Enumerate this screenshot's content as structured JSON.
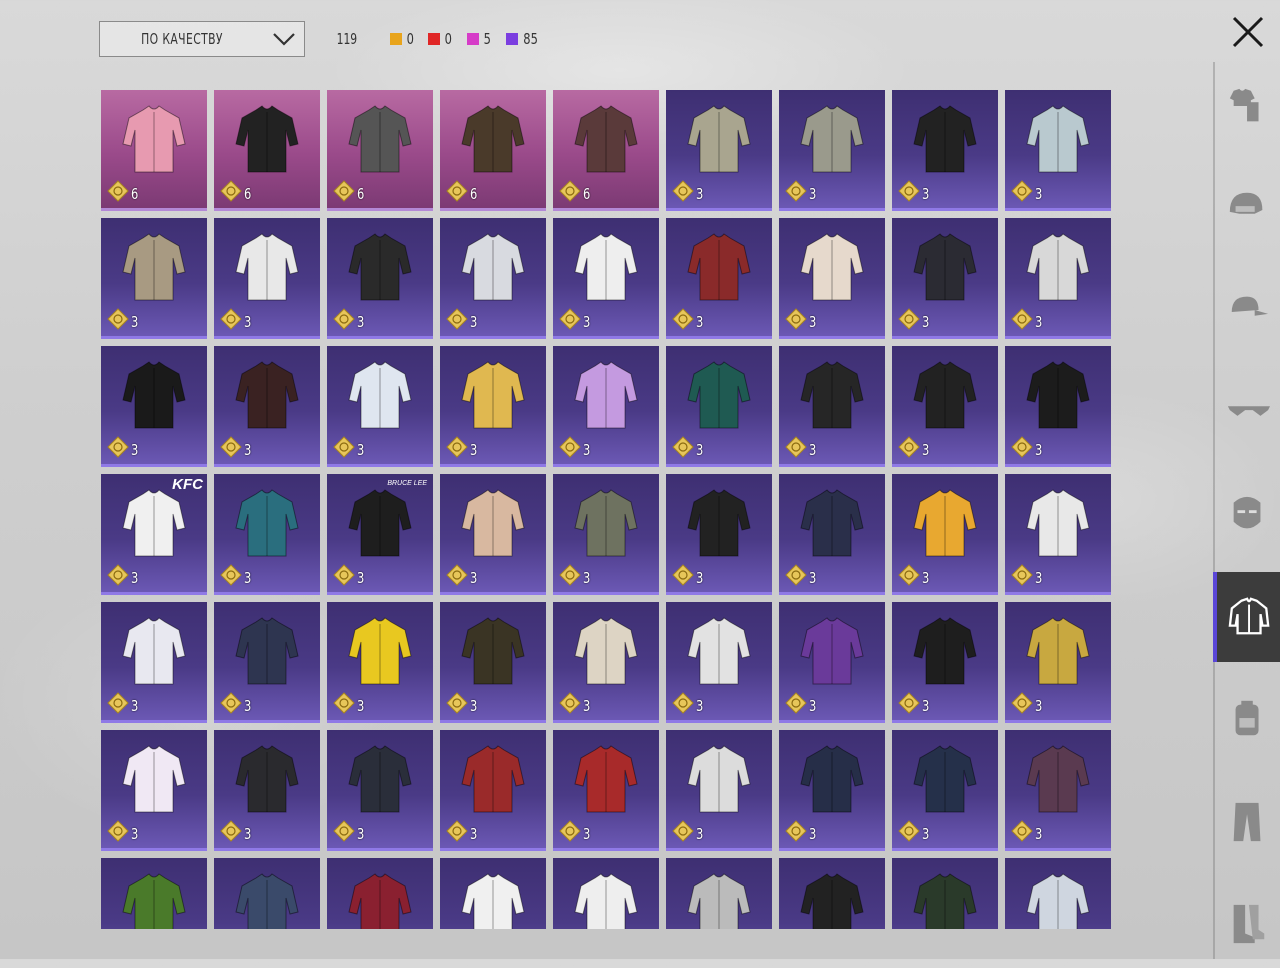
{
  "sort": {
    "label": "ПО КАЧЕСТВУ",
    "icon": "chevron-down-icon"
  },
  "counts": {
    "total": "119",
    "rarities": [
      {
        "name": "legendary-gold",
        "color": "#e8a41c",
        "value": "0"
      },
      {
        "name": "mythic-red",
        "color": "#e02626",
        "value": "0"
      },
      {
        "name": "legendary-pink",
        "color": "#d63cc8",
        "value": "5"
      },
      {
        "name": "epic-purple",
        "color": "#7b3ee0",
        "value": "85"
      }
    ]
  },
  "close_icon": "close-icon",
  "items": [
    {
      "rarity": "legendary",
      "icon": "pink-white-shirt-icon",
      "color": "#e79ab0",
      "count": "6"
    },
    {
      "rarity": "legendary",
      "icon": "black-hoodie-icon",
      "color": "#222222",
      "count": "6"
    },
    {
      "rarity": "legendary",
      "icon": "grey-puffer-jacket-icon",
      "color": "#555555",
      "count": "6"
    },
    {
      "rarity": "legendary",
      "icon": "hooded-long-coat-icon",
      "color": "#4a3a2a",
      "count": "6"
    },
    {
      "rarity": "legendary",
      "icon": "long-trench-coat-icon",
      "color": "#5a3a3a",
      "count": "6"
    },
    {
      "rarity": "epic",
      "icon": "camo-jacket-icon",
      "color": "#a9a58f",
      "count": "3"
    },
    {
      "rarity": "epic",
      "icon": "grey-hoodie-icon",
      "color": "#9a9a8c",
      "count": "3"
    },
    {
      "rarity": "epic",
      "icon": "black-crop-top-icon",
      "color": "#222222",
      "count": "3"
    },
    {
      "rarity": "epic",
      "icon": "floral-shirt-icon",
      "color": "#b9c9cf",
      "count": "3"
    },
    {
      "rarity": "epic",
      "icon": "plaid-jacket-icon",
      "color": "#a89a82",
      "count": "3"
    },
    {
      "rarity": "epic",
      "icon": "white-wrap-top-icon",
      "color": "#e8e8e8",
      "count": "3"
    },
    {
      "rarity": "epic",
      "icon": "black-pubg-hoodie-icon",
      "color": "#2a2a2a",
      "count": "3"
    },
    {
      "rarity": "epic",
      "icon": "white-martial-jacket-icon",
      "color": "#d8dae0",
      "count": "3"
    },
    {
      "rarity": "epic",
      "icon": "white-ruffle-top-icon",
      "color": "#eeeeee",
      "count": "3"
    },
    {
      "rarity": "epic",
      "icon": "red-floral-sweater-icon",
      "color": "#8a2a2a",
      "count": "3"
    },
    {
      "rarity": "epic",
      "icon": "cream-fleece-jacket-icon",
      "color": "#e6d9cc",
      "count": "3"
    },
    {
      "rarity": "epic",
      "icon": "black-leather-jacket-icon",
      "color": "#2b2b33",
      "count": "3"
    },
    {
      "rarity": "epic",
      "icon": "white-crop-jacket-icon",
      "color": "#d8d8d8",
      "count": "3"
    },
    {
      "rarity": "epic",
      "icon": "winner-chicken-tshirt-icon",
      "color": "#1a1a1a",
      "count": "3"
    },
    {
      "rarity": "epic",
      "icon": "black-red-moto-jacket-icon",
      "color": "#3a2222",
      "count": "3"
    },
    {
      "rarity": "epic",
      "icon": "white-sleeveless-shirt-icon",
      "color": "#dfe6f0",
      "count": "3"
    },
    {
      "rarity": "epic",
      "icon": "yellow-blazer-icon",
      "color": "#e0b850",
      "count": "3"
    },
    {
      "rarity": "epic",
      "icon": "lilac-hoodie-icon",
      "color": "#c49ae0",
      "count": "3"
    },
    {
      "rarity": "epic",
      "icon": "teal-hoodie-icon",
      "color": "#1f5a52",
      "count": "3"
    },
    {
      "rarity": "epic",
      "icon": "black-skull-jacket-icon",
      "color": "#262626",
      "count": "3"
    },
    {
      "rarity": "epic",
      "icon": "black-vest-icon",
      "color": "#222222",
      "count": "3"
    },
    {
      "rarity": "epic",
      "icon": "black-crop-hoodie-icon",
      "color": "#1c1c1c",
      "count": "3"
    },
    {
      "rarity": "epic",
      "icon": "kfc-tshirt-icon",
      "color": "#f0f0f0",
      "count": "3",
      "brand": "KFC"
    },
    {
      "rarity": "epic",
      "icon": "teal-graphic-tshirt-icon",
      "color": "#2a6e7e",
      "count": "3"
    },
    {
      "rarity": "epic",
      "icon": "bruce-lee-tshirt-icon",
      "color": "#1e1e1e",
      "count": "3",
      "brand": "BRUCE LEE"
    },
    {
      "rarity": "epic",
      "icon": "bare-torso-icon",
      "color": "#d8b8a0",
      "count": "3"
    },
    {
      "rarity": "epic",
      "icon": "olive-shirt-icon",
      "color": "#6e7260",
      "count": "3"
    },
    {
      "rarity": "epic",
      "icon": "black-gold-jacket-icon",
      "color": "#222222",
      "count": "3"
    },
    {
      "rarity": "epic",
      "icon": "navy-red-jacket-icon",
      "color": "#2a2f4a",
      "count": "3"
    },
    {
      "rarity": "epic",
      "icon": "yellow-sweater-icon",
      "color": "#e8a830",
      "count": "3"
    },
    {
      "rarity": "epic",
      "icon": "green-holiday-sweater-icon",
      "color": "#e8e8e8",
      "count": "3"
    },
    {
      "rarity": "epic",
      "icon": "holiday-sweater-icon",
      "color": "#e8e8f0",
      "count": "3"
    },
    {
      "rarity": "epic",
      "icon": "navy-sweater-icon",
      "color": "#2e3550",
      "count": "3"
    },
    {
      "rarity": "epic",
      "icon": "yellow-robe-icon",
      "color": "#e8c820",
      "count": "3"
    },
    {
      "rarity": "epic",
      "icon": "camo-puffer-icon",
      "color": "#3a3424",
      "count": "3"
    },
    {
      "rarity": "epic",
      "icon": "cream-knit-jacket-icon",
      "color": "#ddd4c4",
      "count": "3"
    },
    {
      "rarity": "epic",
      "icon": "white-apron-shirt-icon",
      "color": "#e2e2e2",
      "count": "3"
    },
    {
      "rarity": "epic",
      "icon": "purple-blazer-icon",
      "color": "#6a3a9a",
      "count": "3"
    },
    {
      "rarity": "epic",
      "icon": "black-walker-shirt-icon",
      "color": "#1e1e1e",
      "count": "3"
    },
    {
      "rarity": "epic",
      "icon": "yellow-black-jacket-icon",
      "color": "#c8a840",
      "count": "3"
    },
    {
      "rarity": "epic",
      "icon": "white-print-tshirt-icon",
      "color": "#f0e8f4",
      "count": "3"
    },
    {
      "rarity": "epic",
      "icon": "black-bomber-icon",
      "color": "#2a2a2e",
      "count": "3"
    },
    {
      "rarity": "epic",
      "icon": "dark-track-jacket-icon",
      "color": "#2a2e3a",
      "count": "3"
    },
    {
      "rarity": "epic",
      "icon": "red-hooded-jacket-icon",
      "color": "#9a2a2a",
      "count": "3"
    },
    {
      "rarity": "epic",
      "icon": "red-black-hoodie-icon",
      "color": "#a82a2a",
      "count": "3"
    },
    {
      "rarity": "epic",
      "icon": "white-hooded-coat-icon",
      "color": "#dcdcdc",
      "count": "3"
    },
    {
      "rarity": "epic",
      "icon": "navy-suit-icon",
      "color": "#262e48",
      "count": "3"
    },
    {
      "rarity": "epic",
      "icon": "navy-hoodie-icon",
      "color": "#25304a",
      "count": "3"
    },
    {
      "rarity": "epic",
      "icon": "plum-hooded-jacket-icon",
      "color": "#5a3a50",
      "count": "3"
    },
    {
      "rarity": "epic",
      "icon": "green-jacket-icon",
      "color": "#4a7a2a",
      "count": ""
    },
    {
      "rarity": "epic",
      "icon": "denim-jacket-icon",
      "color": "#3a4a6a",
      "count": ""
    },
    {
      "rarity": "epic",
      "icon": "red-floral-shirt-icon",
      "color": "#8a2030",
      "count": ""
    },
    {
      "rarity": "epic",
      "icon": "white-shirt-icon",
      "color": "#f0f0f0",
      "count": ""
    },
    {
      "rarity": "epic",
      "icon": "white-tshirt-icon",
      "color": "#eeeeee",
      "count": ""
    },
    {
      "rarity": "epic",
      "icon": "silver-shirt-icon",
      "color": "#bbbbbb",
      "count": ""
    },
    {
      "rarity": "epic",
      "icon": "black-graphic-tshirt-icon",
      "color": "#222222",
      "count": ""
    },
    {
      "rarity": "epic",
      "icon": "green-graphic-tshirt-icon",
      "color": "#2a3a2a",
      "count": ""
    },
    {
      "rarity": "epic",
      "icon": "white-denim-jacket-icon",
      "color": "#cfd6e0",
      "count": ""
    }
  ],
  "sidebar": [
    {
      "name": "sidebar-item-outfit",
      "icon": "outfit-icon",
      "active": false
    },
    {
      "name": "sidebar-item-helmet",
      "icon": "helmet-icon",
      "active": false
    },
    {
      "name": "sidebar-item-hat",
      "icon": "cap-icon",
      "active": false
    },
    {
      "name": "sidebar-item-eyewear",
      "icon": "sunglasses-icon",
      "active": false
    },
    {
      "name": "sidebar-item-mask",
      "icon": "mask-icon",
      "active": false
    },
    {
      "name": "sidebar-item-tops",
      "icon": "jacket-icon",
      "active": true
    },
    {
      "name": "sidebar-item-backpack",
      "icon": "backpack-icon",
      "active": false
    },
    {
      "name": "sidebar-item-pants",
      "icon": "pants-icon",
      "active": false
    },
    {
      "name": "sidebar-item-shoes",
      "icon": "boots-icon",
      "active": false
    }
  ]
}
